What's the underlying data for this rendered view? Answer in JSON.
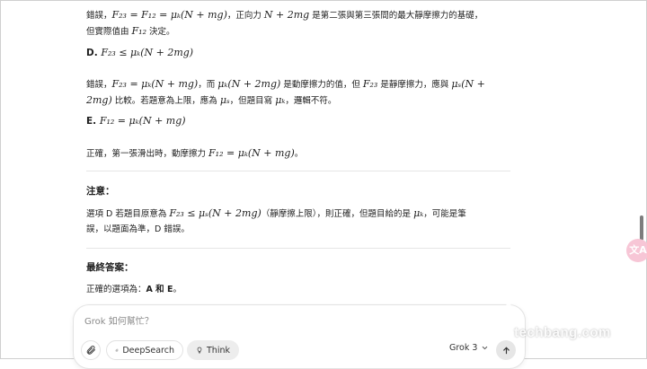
{
  "answer": {
    "line1": {
      "pre": "錯誤，",
      "m1": "F₂₃ = F₁₂ = μₖ(N + mg)",
      "mid": "，正向力 ",
      "m2": "N + 2mg",
      "post": " 是第二張與第三張間的最大靜摩擦力的基礎，"
    },
    "line2": {
      "pre": "但實際值由 ",
      "m1": "F₁₂",
      "post": " 決定。"
    },
    "optD": {
      "label": "D. ",
      "m1": "F₂₃ ≤ μₖ(N + 2mg)"
    },
    "line3": {
      "pre": "錯誤，",
      "m1": "F₂₃ = μₖ(N + mg)",
      "mid1": "，而 ",
      "m2": "μₖ(N + 2mg)",
      "mid2": " 是動摩擦力的值，但 ",
      "m3": "F₂₃",
      "mid3": " 是靜摩擦力，應與 ",
      "m4": "μₛ(N +"
    },
    "line4": {
      "m1": "2mg)",
      "post1": " 比較。若題意為上限，應為 ",
      "m2": "μₛ",
      "post2": "，但題目寫 ",
      "m3": "μₖ",
      "post3": "，邏輯不符。"
    },
    "optE": {
      "label": "E. ",
      "m1": "F₁₂ = μₖ(N + mg)"
    },
    "line5": {
      "pre": "正確，第一張滑出時，動摩擦力 ",
      "m1": "F₁₂ = μₖ(N + mg)",
      "post": "。"
    },
    "note": {
      "heading": "注意：",
      "line1": {
        "pre": "選項 D 若題目原意為 ",
        "m1": "F₂₃ ≤ μₛ(N + 2mg)",
        "mid": "（靜摩擦上限），則正確，但題目給的是 ",
        "m2": "μₖ",
        "post": "，可能是筆"
      },
      "line2": "誤，以題面為準，D 錯誤。"
    },
    "final": {
      "heading": "最終答案：",
      "pre": "正確的選項為：",
      "answer": "A 和 E",
      "post": "。"
    }
  },
  "side_bubble": {
    "label": "文A"
  },
  "composer": {
    "placeholder": "Grok 如何幫忙？",
    "attach_icon": "paperclip-icon",
    "deepsearch_label": "DeepSearch",
    "think_label": "Think",
    "model_label": "Grok 3"
  },
  "watermark": {
    "text": "techbang.com"
  },
  "colors": {
    "accent_pink": "#f7c6d6",
    "think_bg": "#ededed",
    "text": "#1f1f1f"
  }
}
